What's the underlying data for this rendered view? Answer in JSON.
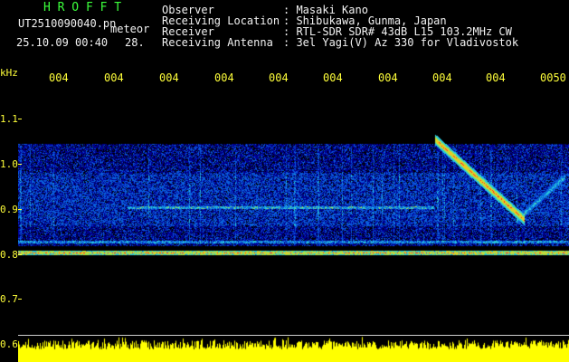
{
  "header": {
    "brand": "H R O F F T",
    "file_name": "UT2510090040.pn",
    "file_tag": "meteor",
    "datetime": "25.10.09 00:40",
    "count": "28."
  },
  "info": [
    {
      "label": "Observer",
      "value": ": Masaki Kano"
    },
    {
      "label": "Receiving Location",
      "value": ": Shibukawa, Gunma, Japan"
    },
    {
      "label": "Receiver",
      "value": ": RTL-SDR SDR# 43dB L15 103.2MHz CW"
    },
    {
      "label": "Receiving Antenna",
      "value": ": 3el Yagi(V) Az 330 for Vladivostok"
    }
  ],
  "axes": {
    "y_unit": "kHz",
    "y_ticks": [
      "1.1",
      "1.0",
      "0.9",
      "0.8",
      "0.7",
      "0.6"
    ],
    "x_ticks": [
      "004",
      "004",
      "004",
      "004",
      "004",
      "004",
      "004",
      "004",
      "004",
      "0050"
    ]
  },
  "colors": {
    "background": "#000000",
    "header_green": "#3cff3c",
    "axis_yellow": "#ffff3a",
    "text_white": "#f2f2f2"
  }
}
